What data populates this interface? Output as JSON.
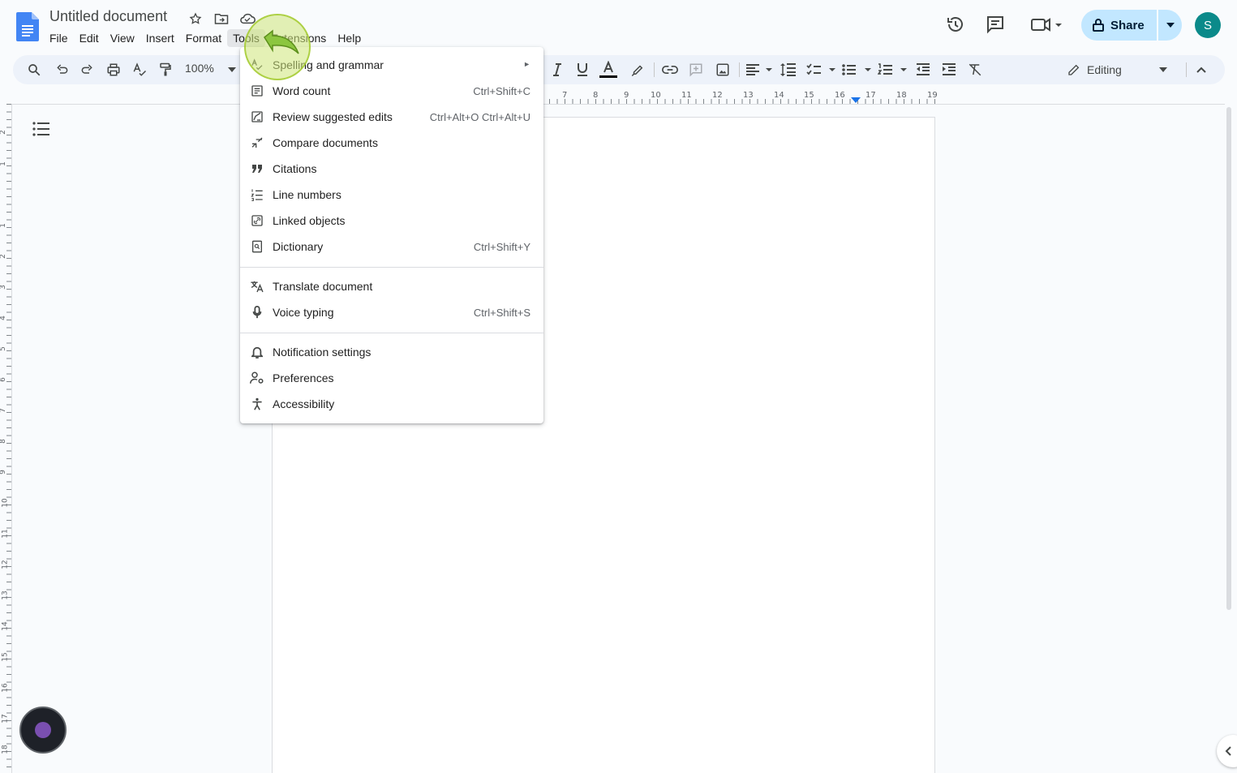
{
  "header": {
    "doc_title": "Untitled document",
    "menus": [
      "File",
      "Edit",
      "View",
      "Insert",
      "Format",
      "Tools",
      "Extensions",
      "Help"
    ],
    "active_menu": "Tools",
    "share_label": "Share",
    "avatar_letter": "S"
  },
  "toolbar": {
    "zoom": "100%",
    "mode_label": "Editing"
  },
  "ruler": {
    "numbers": [
      "7",
      "8",
      "9",
      "10",
      "11",
      "12",
      "13",
      "14",
      "15",
      "16",
      "17",
      "18",
      "19"
    ],
    "vertical_numbers": [
      "2",
      "1",
      "1",
      "2",
      "3",
      "4",
      "5",
      "6",
      "7",
      "8",
      "9",
      "10",
      "11",
      "12",
      "13",
      "14",
      "15",
      "16",
      "17",
      "18"
    ]
  },
  "tools_menu": {
    "items": [
      {
        "label": "Spelling and grammar",
        "shortcut": "",
        "submenu": true,
        "icon": "spellcheck-icon"
      },
      {
        "label": "Word count",
        "shortcut": "Ctrl+Shift+C",
        "icon": "word-count-icon"
      },
      {
        "label": "Review suggested edits",
        "shortcut": "Ctrl+Alt+O Ctrl+Alt+U",
        "icon": "review-edits-icon"
      },
      {
        "label": "Compare documents",
        "shortcut": "",
        "icon": "compare-icon"
      },
      {
        "label": "Citations",
        "shortcut": "",
        "icon": "quote-icon"
      },
      {
        "label": "Line numbers",
        "shortcut": "",
        "icon": "line-numbers-icon"
      },
      {
        "label": "Linked objects",
        "shortcut": "",
        "icon": "linked-objects-icon"
      },
      {
        "label": "Dictionary",
        "shortcut": "Ctrl+Shift+Y",
        "icon": "dictionary-icon"
      },
      {
        "label": "Translate document",
        "shortcut": "",
        "icon": "translate-icon"
      },
      {
        "label": "Voice typing",
        "shortcut": "Ctrl+Shift+S",
        "icon": "mic-icon"
      },
      {
        "label": "Notification settings",
        "shortcut": "",
        "icon": "bell-icon"
      },
      {
        "label": "Preferences",
        "shortcut": "",
        "icon": "preferences-icon"
      },
      {
        "label": "Accessibility",
        "shortcut": "",
        "icon": "accessibility-icon"
      }
    ]
  },
  "colors": {
    "accent": "#1a73e8",
    "share_bg": "#c2e7ff",
    "toolbar_bg": "#edf2fa",
    "avatar": "#0b8a8a",
    "click_highlight": "#b7d86b"
  }
}
